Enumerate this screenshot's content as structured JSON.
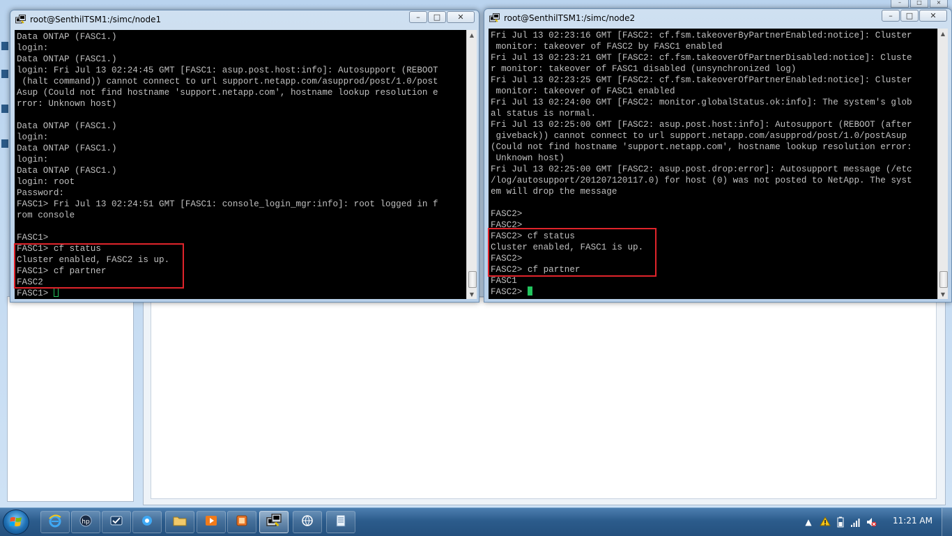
{
  "windows": [
    {
      "title": "root@SenthilTSM1:/simc/node1",
      "lines": [
        "Data ONTAP (FASC1.)",
        "login:",
        "Data ONTAP (FASC1.)",
        "login: Fri Jul 13 02:24:45 GMT [FASC1: asup.post.host:info]: Autosupport (REBOOT",
        " (halt command)) cannot connect to url support.netapp.com/asupprod/post/1.0/post",
        "Asup (Could not find hostname 'support.netapp.com', hostname lookup resolution e",
        "rror: Unknown host)",
        "",
        "Data ONTAP (FASC1.)",
        "login:",
        "Data ONTAP (FASC1.)",
        "login:",
        "Data ONTAP (FASC1.)",
        "login: root",
        "Password:",
        "FASC1> Fri Jul 13 02:24:51 GMT [FASC1: console_login_mgr:info]: root logged in f",
        "rom console",
        "",
        "FASC1>",
        "FASC1> cf status",
        "Cluster enabled, FASC2 is up.",
        "FASC1> cf partner",
        "FASC2"
      ],
      "prompt": "FASC1> "
    },
    {
      "title": "root@SenthilTSM1:/simc/node2",
      "lines": [
        "Fri Jul 13 02:23:16 GMT [FASC2: cf.fsm.takeoverByPartnerEnabled:notice]: Cluster",
        " monitor: takeover of FASC2 by FASC1 enabled",
        "Fri Jul 13 02:23:21 GMT [FASC2: cf.fsm.takeoverOfPartnerDisabled:notice]: Cluste",
        "r monitor: takeover of FASC1 disabled (unsynchronized log)",
        "Fri Jul 13 02:23:25 GMT [FASC2: cf.fsm.takeoverOfPartnerEnabled:notice]: Cluster",
        " monitor: takeover of FASC1 enabled",
        "Fri Jul 13 02:24:00 GMT [FASC2: monitor.globalStatus.ok:info]: The system's glob",
        "al status is normal.",
        "Fri Jul 13 02:25:00 GMT [FASC2: asup.post.host:info]: Autosupport (REBOOT (after",
        " giveback)) cannot connect to url support.netapp.com/asupprod/post/1.0/postAsup",
        "(Could not find hostname 'support.netapp.com', hostname lookup resolution error:",
        " Unknown host)",
        "Fri Jul 13 02:25:00 GMT [FASC2: asup.post.drop:error]: Autosupport message (/etc",
        "/log/autosupport/201207120117.0) for host (0) was not posted to NetApp. The syst",
        "em will drop the message",
        "",
        "FASC2>",
        "FASC2>",
        "FASC2> cf status",
        "Cluster enabled, FASC1 is up.",
        "FASC2>",
        "FASC2> cf partner",
        "FASC1"
      ],
      "prompt": "FASC2> "
    }
  ],
  "taskbar": {
    "clock": "11:21 AM",
    "items": [
      "ie-icon",
      "hp-icon",
      "mail-icon",
      "media-icon",
      "folder-icon",
      "player-icon",
      "app-icon",
      "putty-icon",
      "network-icon",
      "notepad-icon"
    ]
  },
  "colors": {
    "highlight": "#e0242b",
    "cursor": "#22c55e",
    "terminal_bg": "#000000",
    "terminal_fg": "#c0c0c0"
  }
}
